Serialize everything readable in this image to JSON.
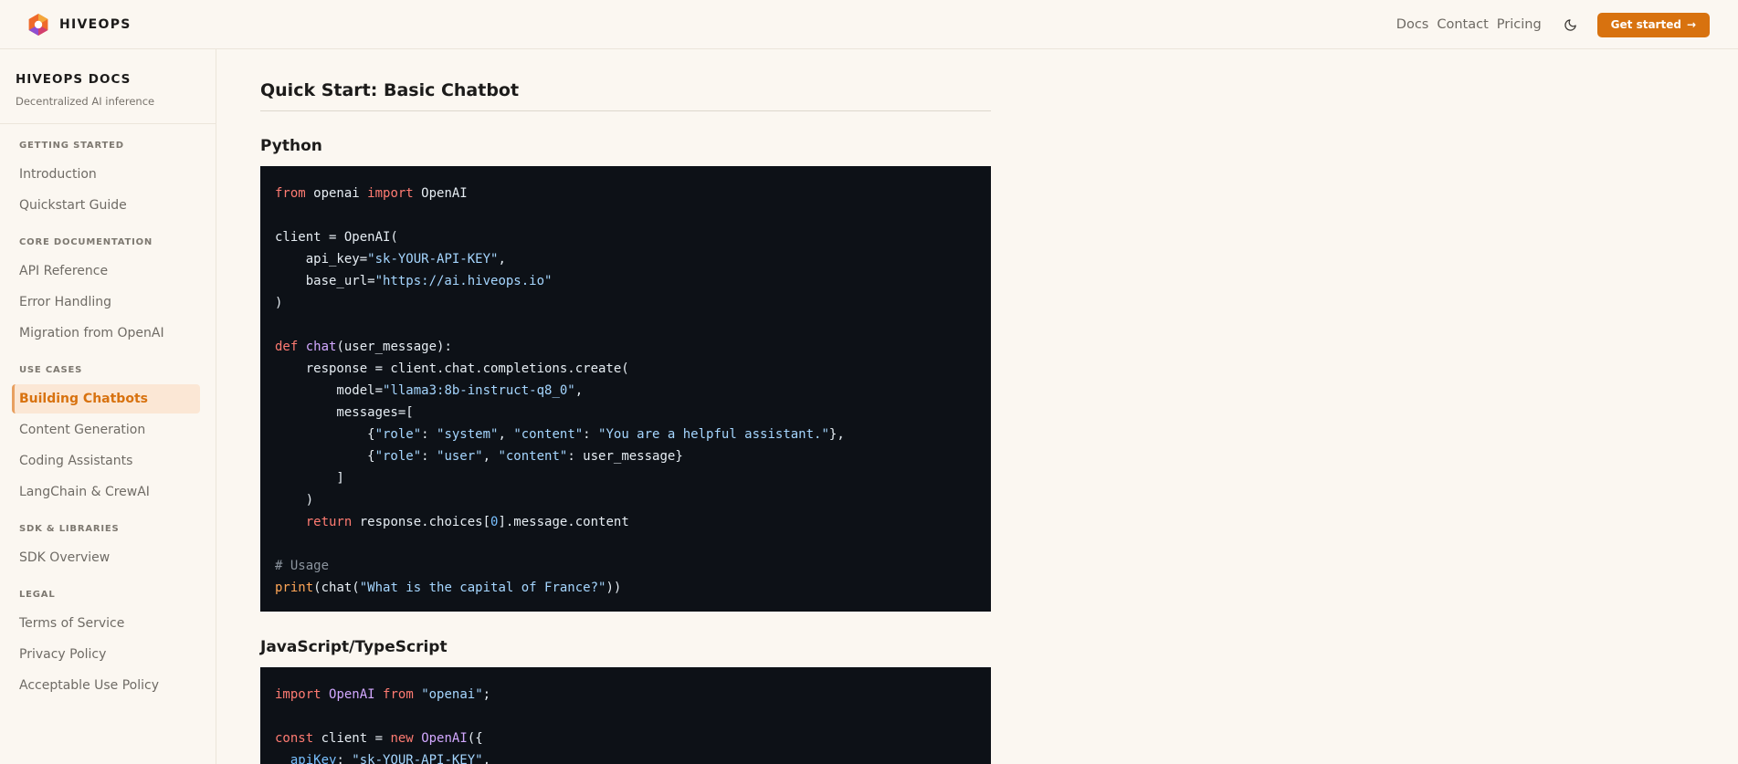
{
  "header": {
    "brand": "HIVEOPS",
    "nav": [
      "Docs",
      "Contact",
      "Pricing"
    ],
    "cta_label": "Get started",
    "cta_arrow": "→"
  },
  "sidebar": {
    "title": "HIVEOPS DOCS",
    "subtitle": "Decentralized AI inference",
    "sections": [
      {
        "title": "GETTING STARTED",
        "items": [
          "Introduction",
          "Quickstart Guide"
        ]
      },
      {
        "title": "CORE DOCUMENTATION",
        "items": [
          "API Reference",
          "Error Handling",
          "Migration from OpenAI"
        ]
      },
      {
        "title": "USE CASES",
        "items": [
          "Building Chatbots",
          "Content Generation",
          "Coding Assistants",
          "LangChain & CrewAI"
        ]
      },
      {
        "title": "SDK & LIBRARIES",
        "items": [
          "SDK Overview"
        ]
      },
      {
        "title": "LEGAL",
        "items": [
          "Terms of Service",
          "Privacy Policy",
          "Acceptable Use Policy"
        ]
      }
    ],
    "active_item": "Building Chatbots"
  },
  "main": {
    "title": "Quick Start: Basic Chatbot",
    "python_heading": "Python",
    "js_heading": "JavaScript/TypeScript",
    "python_code": [
      [
        [
          "kw",
          "from"
        ],
        [
          "t",
          " openai "
        ],
        [
          "kw",
          "import"
        ],
        [
          "t",
          " OpenAI"
        ]
      ],
      [],
      [
        [
          "t",
          "client = OpenAI("
        ]
      ],
      [
        [
          "t",
          "    api_key="
        ],
        [
          "str",
          "\"sk-YOUR-API-KEY\""
        ],
        [
          "t",
          ","
        ]
      ],
      [
        [
          "t",
          "    base_url="
        ],
        [
          "str",
          "\"https://ai.hiveops.io\""
        ]
      ],
      [
        [
          "t",
          ")"
        ]
      ],
      [],
      [
        [
          "kw",
          "def"
        ],
        [
          "t",
          " "
        ],
        [
          "fn",
          "chat"
        ],
        [
          "t",
          "(user_message):"
        ]
      ],
      [
        [
          "t",
          "    response = client.chat.completions.create("
        ]
      ],
      [
        [
          "t",
          "        model="
        ],
        [
          "str",
          "\"llama3:8b-instruct-q8_0\""
        ],
        [
          "t",
          ","
        ]
      ],
      [
        [
          "t",
          "        messages=["
        ]
      ],
      [
        [
          "t",
          "            {"
        ],
        [
          "str",
          "\"role\""
        ],
        [
          "t",
          ": "
        ],
        [
          "str",
          "\"system\""
        ],
        [
          "t",
          ", "
        ],
        [
          "str",
          "\"content\""
        ],
        [
          "t",
          ": "
        ],
        [
          "str",
          "\"You are a helpful assistant.\""
        ],
        [
          "t",
          "},"
        ]
      ],
      [
        [
          "t",
          "            {"
        ],
        [
          "str",
          "\"role\""
        ],
        [
          "t",
          ": "
        ],
        [
          "str",
          "\"user\""
        ],
        [
          "t",
          ", "
        ],
        [
          "str",
          "\"content\""
        ],
        [
          "t",
          ": user_message}"
        ]
      ],
      [
        [
          "t",
          "        ]"
        ]
      ],
      [
        [
          "t",
          "    )"
        ]
      ],
      [
        [
          "t",
          "    "
        ],
        [
          "kw",
          "return"
        ],
        [
          "t",
          " response.choices["
        ],
        [
          "num",
          "0"
        ],
        [
          "t",
          "].message.content"
        ]
      ],
      [],
      [
        [
          "cm",
          "# Usage"
        ]
      ],
      [
        [
          "bi",
          "print"
        ],
        [
          "t",
          "(chat("
        ],
        [
          "str",
          "\"What is the capital of France?\""
        ],
        [
          "t",
          "))"
        ]
      ]
    ],
    "js_code": [
      [
        [
          "kw",
          "import"
        ],
        [
          "t",
          " "
        ],
        [
          "fn",
          "OpenAI"
        ],
        [
          "t",
          " "
        ],
        [
          "kw",
          "from"
        ],
        [
          "t",
          " "
        ],
        [
          "str",
          "\"openai\""
        ],
        [
          "t",
          ";"
        ]
      ],
      [],
      [
        [
          "kw",
          "const"
        ],
        [
          "t",
          " client = "
        ],
        [
          "kw",
          "new"
        ],
        [
          "t",
          " "
        ],
        [
          "fn",
          "OpenAI"
        ],
        [
          "t",
          "({"
        ]
      ],
      [
        [
          "t",
          "  "
        ],
        [
          "prop",
          "apiKey"
        ],
        [
          "t",
          ": "
        ],
        [
          "str",
          "\"sk-YOUR-API-KEY\""
        ],
        [
          "t",
          ","
        ]
      ]
    ]
  },
  "colors": {
    "accent": "#d8720f",
    "active_bg": "#fbe7d5",
    "code_bg": "#0d1117"
  }
}
